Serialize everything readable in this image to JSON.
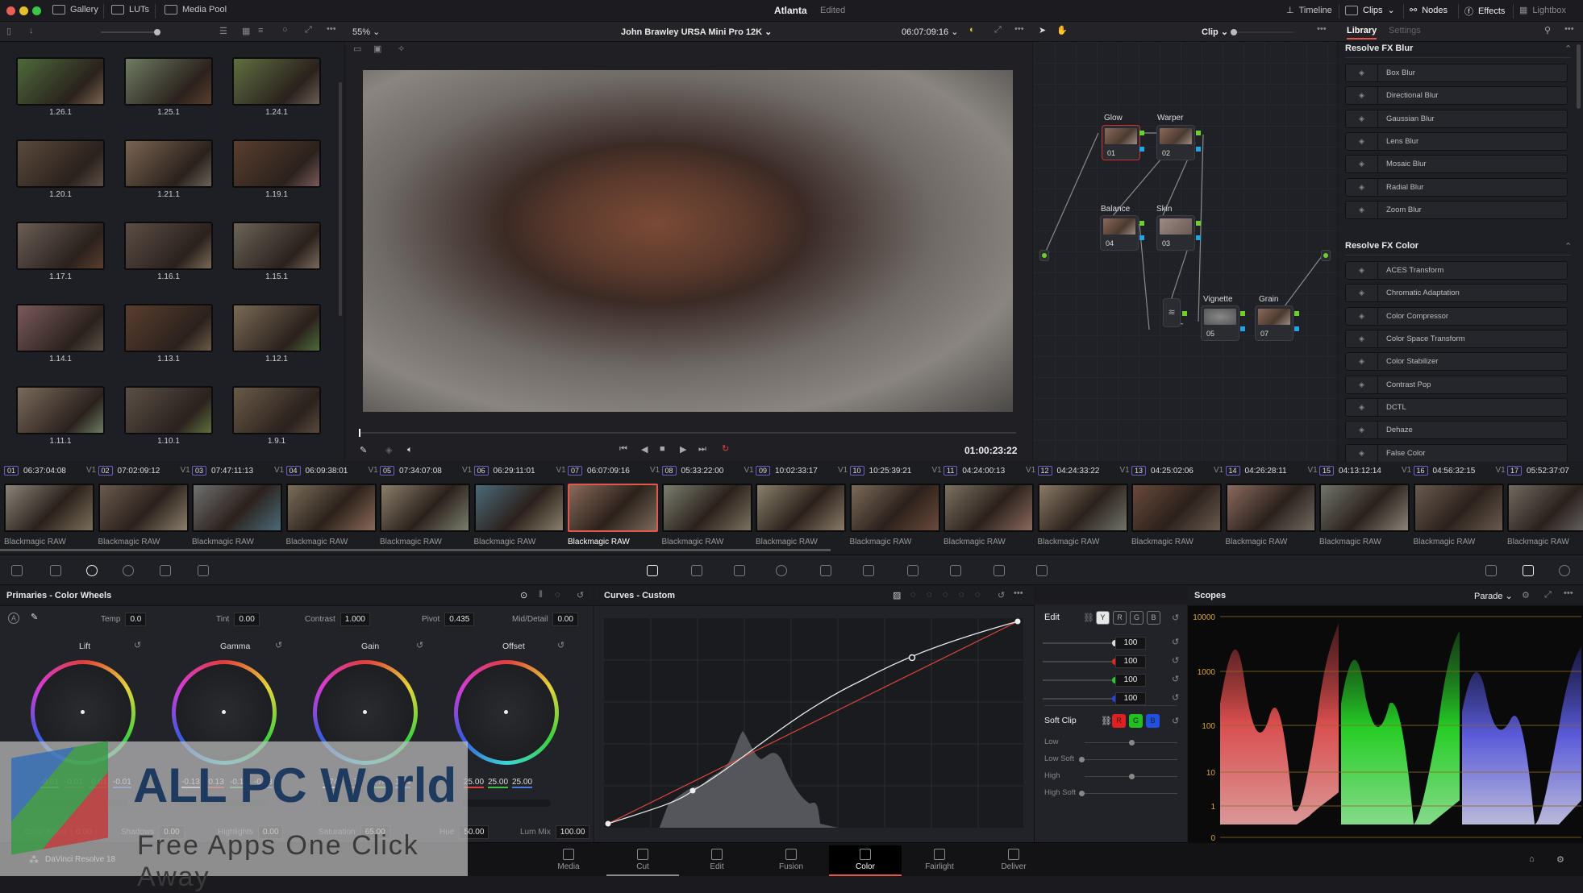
{
  "titlebar": {
    "tabs_left": [
      "Gallery",
      "LUTs",
      "Media Pool"
    ],
    "project_title": "Atlanta",
    "project_status": "Edited",
    "tabs_right": [
      "Timeline",
      "Clips",
      "Nodes",
      "Effects",
      "Lightbox"
    ]
  },
  "viewer": {
    "zoom": "55%",
    "clip_name": "John Brawley URSA Mini Pro 12K",
    "source_timecode": "06:07:09:16",
    "playhead_timecode": "01:00:23:22",
    "node_mode": "Clip"
  },
  "gallery": {
    "stills": [
      "1.26.1",
      "1.25.1",
      "1.24.1",
      "1.20.1",
      "1.21.1",
      "1.19.1",
      "1.17.1",
      "1.16.1",
      "1.15.1",
      "1.14.1",
      "1.13.1",
      "1.12.1",
      "1.11.1",
      "1.10.1",
      "1.9.1"
    ]
  },
  "nodes": [
    {
      "label": "Glow",
      "num": "01"
    },
    {
      "label": "Warper",
      "num": "02"
    },
    {
      "label": "Balance",
      "num": "04"
    },
    {
      "label": "Skin",
      "num": "03"
    },
    {
      "label": "Vignette",
      "num": "05"
    },
    {
      "label": "Grain",
      "num": "07"
    }
  ],
  "effects": {
    "tabs": [
      "Library",
      "Settings"
    ],
    "groups": [
      {
        "title": "Resolve FX Blur",
        "items": [
          "Box Blur",
          "Directional Blur",
          "Gaussian Blur",
          "Lens Blur",
          "Mosaic Blur",
          "Radial Blur",
          "Zoom Blur"
        ]
      },
      {
        "title": "Resolve FX Color",
        "items": [
          "ACES Transform",
          "Chromatic Adaptation",
          "Color Compressor",
          "Color Space Transform",
          "Color Stabilizer",
          "Contrast Pop",
          "DCTL",
          "Dehaze",
          "False Color"
        ]
      }
    ]
  },
  "timeline_clips": [
    {
      "num": "01",
      "tc": "06:37:04:08",
      "track": "V1",
      "codec": "Blackmagic RAW"
    },
    {
      "num": "02",
      "tc": "07:02:09:12",
      "track": "V1",
      "codec": "Blackmagic RAW"
    },
    {
      "num": "03",
      "tc": "07:47:11:13",
      "track": "V1",
      "codec": "Blackmagic RAW"
    },
    {
      "num": "04",
      "tc": "06:09:38:01",
      "track": "V1",
      "codec": "Blackmagic RAW"
    },
    {
      "num": "05",
      "tc": "07:34:07:08",
      "track": "V1",
      "codec": "Blackmagic RAW"
    },
    {
      "num": "06",
      "tc": "06:29:11:01",
      "track": "V1",
      "codec": "Blackmagic RAW"
    },
    {
      "num": "07",
      "tc": "06:07:09:16",
      "track": "V1",
      "codec": "Blackmagic RAW",
      "selected": true
    },
    {
      "num": "08",
      "tc": "05:33:22:00",
      "track": "V1",
      "codec": "Blackmagic RAW"
    },
    {
      "num": "09",
      "tc": "10:02:33:17",
      "track": "V1",
      "codec": "Blackmagic RAW"
    },
    {
      "num": "10",
      "tc": "10:25:39:21",
      "track": "V1",
      "codec": "Blackmagic RAW"
    },
    {
      "num": "11",
      "tc": "04:24:00:13",
      "track": "V1",
      "codec": "Blackmagic RAW"
    },
    {
      "num": "12",
      "tc": "04:24:33:22",
      "track": "V1",
      "codec": "Blackmagic RAW"
    },
    {
      "num": "13",
      "tc": "04:25:02:06",
      "track": "V1",
      "codec": "Blackmagic RAW"
    },
    {
      "num": "14",
      "tc": "04:26:28:11",
      "track": "V1",
      "codec": "Blackmagic RAW"
    },
    {
      "num": "15",
      "tc": "04:13:12:14",
      "track": "V1",
      "codec": "Blackmagic RAW"
    },
    {
      "num": "16",
      "tc": "04:56:32:15",
      "track": "V1",
      "codec": "Blackmagic RAW"
    },
    {
      "num": "17",
      "tc": "05:52:37:07",
      "track": "",
      "codec": "Blackmagic RAW"
    }
  ],
  "primaries": {
    "title": "Primaries - Color Wheels",
    "params": [
      {
        "label": "Temp",
        "value": "0.0"
      },
      {
        "label": "Tint",
        "value": "0.00"
      },
      {
        "label": "Contrast",
        "value": "1.000"
      },
      {
        "label": "Pivot",
        "value": "0.435"
      },
      {
        "label": "Mid/Detail",
        "value": "0.00"
      }
    ],
    "wheels": [
      {
        "name": "Lift",
        "values": [
          "-0.01",
          "-0.01",
          "-0.01",
          "-0.01"
        ]
      },
      {
        "name": "Gamma",
        "values": [
          "-0.13",
          "-0.13",
          "-0.13",
          "-0.13"
        ]
      },
      {
        "name": "Gain",
        "values": [
          "1.74",
          "1.74",
          "1.74",
          "1.74"
        ]
      },
      {
        "name": "Offset",
        "values": [
          "25.00",
          "25.00",
          "25.00"
        ]
      }
    ],
    "bottom": [
      {
        "label": "Color Boost",
        "value": "0.00"
      },
      {
        "label": "Shadows",
        "value": "0.00"
      },
      {
        "label": "Highlights",
        "value": "0.00"
      },
      {
        "label": "Saturation",
        "value": "65.00"
      },
      {
        "label": "Hue",
        "value": "50.00"
      },
      {
        "label": "Lum Mix",
        "value": "100.00"
      }
    ]
  },
  "curves": {
    "title": "Curves - Custom",
    "edit_label": "Edit",
    "channels": [
      "Y",
      "R",
      "G",
      "B"
    ],
    "intensities": [
      "100",
      "100",
      "100",
      "100"
    ],
    "soft_clip_label": "Soft Clip",
    "soft_clip_channels": [
      "R",
      "G",
      "B"
    ],
    "soft_clip_rows": [
      "Low",
      "Low Soft",
      "High",
      "High Soft"
    ]
  },
  "scopes": {
    "title": "Scopes",
    "mode": "Parade",
    "scale": [
      "10000",
      "1000",
      "100",
      "10",
      "1",
      "0"
    ]
  },
  "pages": [
    "Media",
    "Cut",
    "Edit",
    "Fusion",
    "Color",
    "Fairlight",
    "Deliver"
  ],
  "active_page": "Color",
  "app_name": "DaVinci Resolve 18",
  "watermark": {
    "title": "ALL PC World",
    "subtitle": "Free Apps One Click Away"
  }
}
